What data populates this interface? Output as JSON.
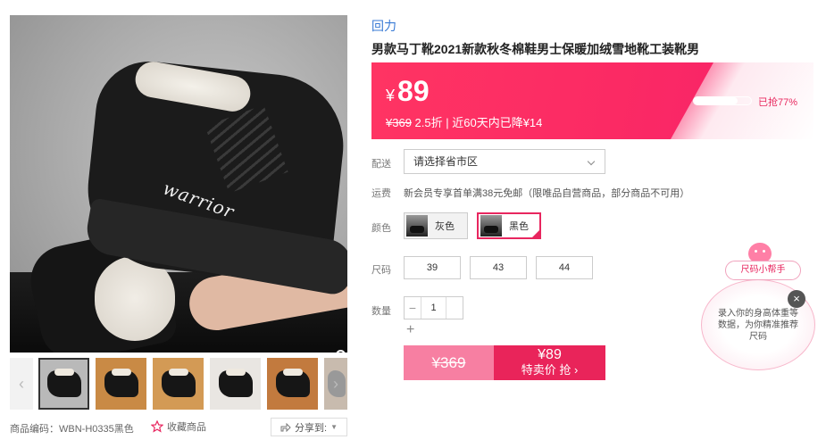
{
  "product": {
    "brand": "回力",
    "title": "男款马丁靴2021新款秋冬棉鞋男士保暖加绒雪地靴工装靴男",
    "image_text": "warrior"
  },
  "price": {
    "currency": "¥",
    "sale": "89",
    "original_line": "¥369",
    "discount": "2.5折",
    "note": "| 近60天内已降¥14",
    "sold_label": "已抢77%",
    "sold_fraction": 0.77
  },
  "options": {
    "shipping_label": "配送",
    "region_placeholder": "请选择省市区",
    "freight_label": "运费",
    "freight_text": "新会员专享首单满38元免邮（限唯品自营商品，部分商品不可用）",
    "color_label": "颜色",
    "colors": [
      {
        "name": "灰色",
        "selected": false
      },
      {
        "name": "黑色",
        "selected": true
      }
    ],
    "size_label": "尺码",
    "sizes": [
      "39",
      "43",
      "44"
    ],
    "qty_label": "数量",
    "qty_value": "1",
    "minus": "−",
    "plus": "+"
  },
  "buy": {
    "orig_price": "¥369",
    "sale_price": "¥89",
    "buy_label": "特卖价 抢 ›"
  },
  "gallery": {
    "sku": "商品编码：WBN-H0335黑色",
    "favorite_label": "收藏商品",
    "share_label": "分享到:",
    "thumb_count": 6
  },
  "helper": {
    "title": "尺码小帮手",
    "text": "录入你的身高体重等数据，为你精准推荐尺码",
    "close": "×"
  },
  "colors": {
    "accent": "#e9245a",
    "banner": "#fb2a64",
    "link": "#3a7bd5"
  }
}
